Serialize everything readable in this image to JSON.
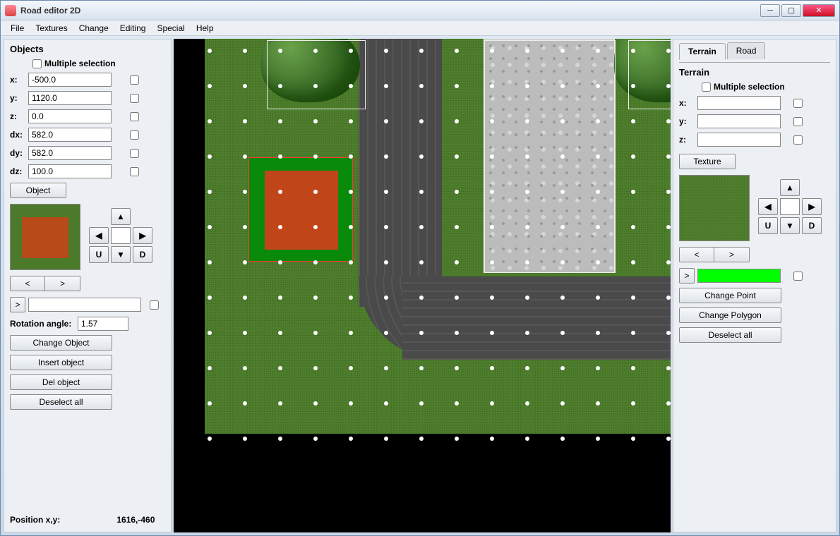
{
  "window": {
    "title": "Road editor 2D"
  },
  "menu": {
    "file": "File",
    "textures": "Textures",
    "change": "Change",
    "editing": "Editing",
    "special": "Special",
    "help": "Help"
  },
  "objects_panel": {
    "title": "Objects",
    "multiple_selection": "Multiple selection",
    "labels": {
      "x": "x:",
      "y": "y:",
      "z": "z:",
      "dx": "dx:",
      "dy": "dy:",
      "dz": "dz:"
    },
    "x": "-500.0",
    "y": "1120.0",
    "z": "0.0",
    "dx": "582.0",
    "dy": "582.0",
    "dz": "100.0",
    "object_btn": "Object",
    "nav": {
      "up": "▲",
      "down": "▼",
      "left": "◀",
      "right": "▶",
      "u": "U",
      "d": "D",
      "value": ""
    },
    "prev": "<",
    "next": ">",
    "goto": ">",
    "goto_value": "",
    "rotation_label": "Rotation angle:",
    "rotation_value": "1.57",
    "change_object": "Change Object",
    "insert_object": "Insert object",
    "del_object": "Del object",
    "deselect_all": "Deselect all"
  },
  "right_panel": {
    "tabs": {
      "terrain": "Terrain",
      "road": "Road"
    },
    "terrain_title": "Terrain",
    "multiple_selection": "Multiple selection",
    "labels": {
      "x": "x:",
      "y": "y:",
      "z": "z:"
    },
    "x": "",
    "y": "",
    "z": "",
    "texture_btn": "Texture",
    "nav": {
      "up": "▲",
      "down": "▼",
      "left": "◀",
      "right": "▶",
      "u": "U",
      "d": "D",
      "value": ""
    },
    "prev": "<",
    "next": ">",
    "goto": ">",
    "color": "#00ff00",
    "change_point": "Change Point",
    "change_polygon": "Change Polygon",
    "deselect_all": "Deselect all"
  },
  "status": {
    "label": "Position x,y:",
    "value": "1616,-460"
  }
}
